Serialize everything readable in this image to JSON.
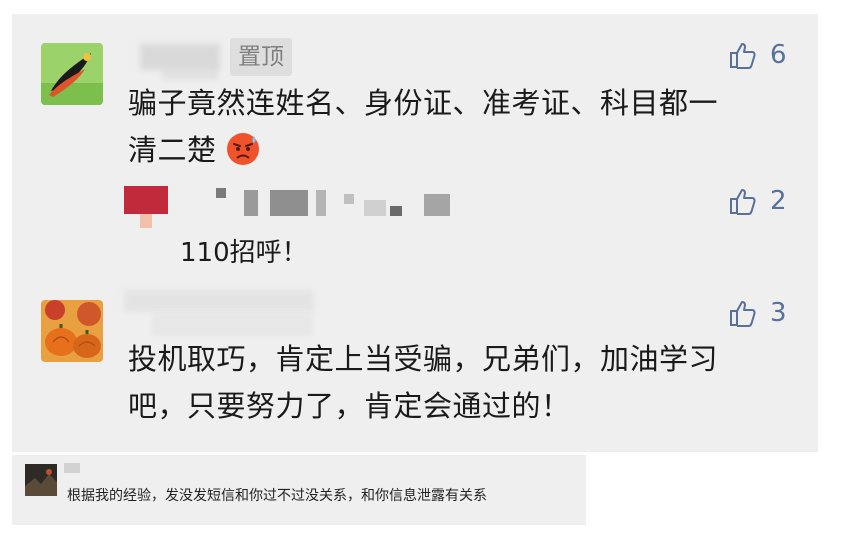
{
  "comments": [
    {
      "pin_label": "置顶",
      "likes": "6",
      "text_line1": "骗子竟然连姓名、身份证、准考证、科目都一",
      "text_line2": "清二楚",
      "reply": {
        "likes": "2",
        "text": "110招呼！"
      }
    },
    {
      "likes": "3",
      "text_line1": "投机取巧，肯定上当受骗，兄弟们，加油学习",
      "text_line2": "吧，只要努力了，肯定会通过的！"
    }
  ],
  "bottom_comment": {
    "text": "根据我的经验，发没发短信和你过不过没关系，和你信息泄露有关系"
  },
  "icons": {
    "like": "thumbs-up-icon",
    "emoji": "sweat-angry-face-icon"
  },
  "colors": {
    "like": "#57709c",
    "card_bg": "#efefef"
  }
}
